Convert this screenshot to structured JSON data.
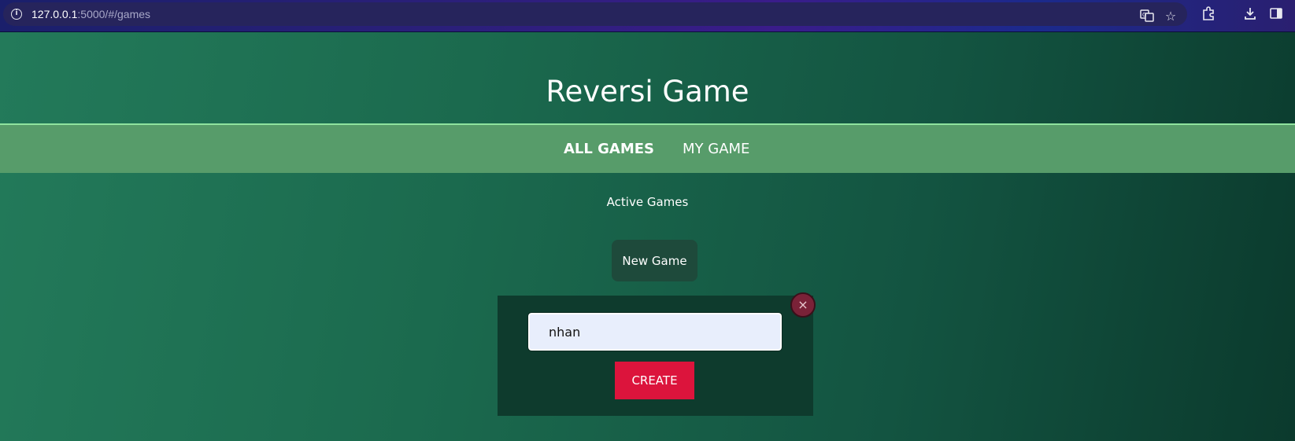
{
  "browser": {
    "url_host": "127.0.0.1",
    "url_rest": ":5000/#/games",
    "icons": [
      "info-icon",
      "translate-icon",
      "star-icon",
      "extensions-icon",
      "download-icon",
      "side-panel-icon"
    ]
  },
  "header": {
    "title": "Reversi Game"
  },
  "nav": {
    "items": [
      {
        "label": "ALL GAMES",
        "active": true
      },
      {
        "label": "MY GAME",
        "active": false
      }
    ]
  },
  "main": {
    "section_title": "Active Games",
    "new_game_label": "New Game"
  },
  "modal": {
    "name_value": "nhan",
    "create_label": "CREATE",
    "close_glyph": "×"
  },
  "colors": {
    "nav_bg": "#579c6a",
    "create_button": "#dc143c",
    "close_button": "#7a2238"
  }
}
